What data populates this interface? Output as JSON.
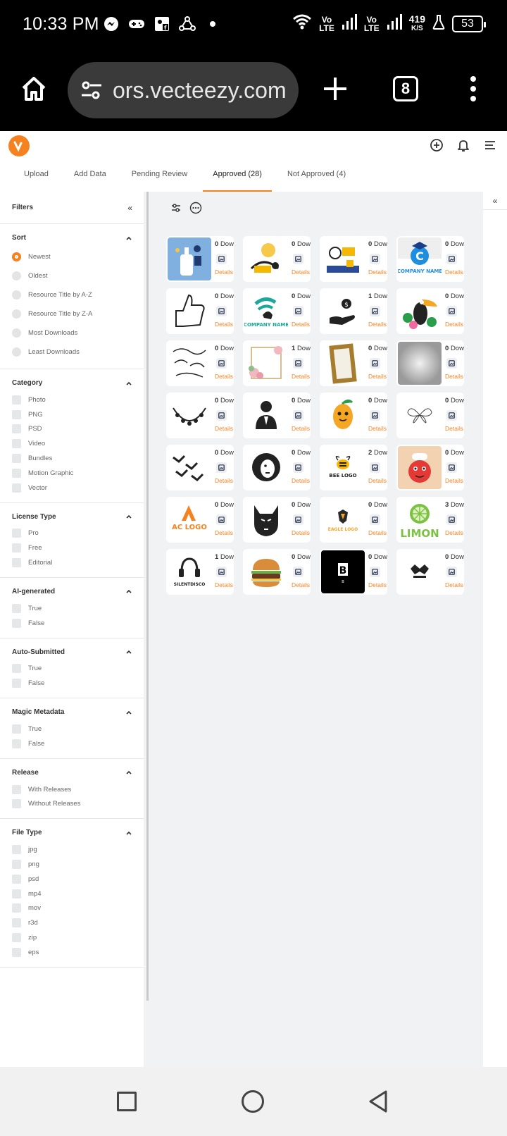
{
  "status": {
    "time": "10:33 PM",
    "lte1_top": "Vo",
    "lte1_bottom": "LTE",
    "lte2_top": "Vo",
    "lte2_bottom": "LTE",
    "speed_value": "419",
    "speed_unit": "K/S",
    "battery": "53",
    "icons_left": [
      "messenger-icon",
      "gamepad-icon",
      "facebook-contact-icon",
      "network-icon",
      "dot-icon"
    ],
    "icons_right": [
      "wifi-icon",
      "signal-icon",
      "signal-icon",
      "flask-icon",
      "battery-icon"
    ]
  },
  "browser": {
    "url": "ors.vecteezy.com",
    "tab_count": "8"
  },
  "header": {
    "tabs": [
      {
        "label": "Upload"
      },
      {
        "label": "Add Data"
      },
      {
        "label": "Pending Review"
      },
      {
        "label": "Approved (28)"
      },
      {
        "label": "Not Approved (4)"
      }
    ],
    "active_tab": "Approved (28)",
    "accent": "#f5821f"
  },
  "sidebar": {
    "title": "Filters",
    "sort": {
      "title": "Sort",
      "options": [
        "Newest",
        "Oldest",
        "Resource Title by A-Z",
        "Resource Title by Z-A",
        "Most Downloads",
        "Least Downloads"
      ],
      "selected": "Newest"
    },
    "category": {
      "title": "Category",
      "options": [
        "Photo",
        "PNG",
        "PSD",
        "Video",
        "Bundles",
        "Motion Graphic",
        "Vector"
      ]
    },
    "license": {
      "title": "License Type",
      "options": [
        "Pro",
        "Free",
        "Editorial"
      ]
    },
    "ai": {
      "title": "AI-generated",
      "options": [
        "True",
        "False"
      ]
    },
    "auto": {
      "title": "Auto-Submitted",
      "options": [
        "True",
        "False"
      ]
    },
    "magic": {
      "title": "Magic Metadata",
      "options": [
        "True",
        "False"
      ]
    },
    "release": {
      "title": "Release",
      "options": [
        "With Releases",
        "Without Releases"
      ]
    },
    "filetype": {
      "title": "File Type",
      "options": [
        "jpg",
        "png",
        "psd",
        "mp4",
        "mov",
        "r3d",
        "zip",
        "eps"
      ]
    }
  },
  "grid": {
    "details_label": "Details",
    "items": [
      {
        "downloads": "0",
        "suffix": "Downlo",
        "thumb": "hand-robot"
      },
      {
        "downloads": "0",
        "suffix": "Downlo",
        "thumb": "person-idea"
      },
      {
        "downloads": "0",
        "suffix": "Downlo",
        "thumb": "search-scene"
      },
      {
        "downloads": "0",
        "suffix": "Downloac",
        "thumb": "company-c",
        "text": "COMPANY NAME"
      },
      {
        "downloads": "0",
        "suffix": "Downlo",
        "thumb": "thumbs-up"
      },
      {
        "downloads": "0",
        "suffix": "Downlo",
        "thumb": "company-wave",
        "text": "COMPANY NAME"
      },
      {
        "downloads": "1",
        "suffix": "Downlo",
        "thumb": "hand-money"
      },
      {
        "downloads": "0",
        "suffix": "Downloac",
        "thumb": "toucan"
      },
      {
        "downloads": "0",
        "suffix": "Downlo",
        "thumb": "ornaments"
      },
      {
        "downloads": "1",
        "suffix": "Downlo",
        "thumb": "floral-frame"
      },
      {
        "downloads": "0",
        "suffix": "Downlo",
        "thumb": "gold-frame"
      },
      {
        "downloads": "0",
        "suffix": "Downloac",
        "thumb": "gray-gradient"
      },
      {
        "downloads": "0",
        "suffix": "Downlo",
        "thumb": "wreath"
      },
      {
        "downloads": "0",
        "suffix": "Downlo",
        "thumb": "person-icon"
      },
      {
        "downloads": "0",
        "suffix": "Downlo",
        "thumb": "mango"
      },
      {
        "downloads": "0",
        "suffix": "Downloac",
        "thumb": "butterfly"
      },
      {
        "downloads": "0",
        "suffix": "Downlo",
        "thumb": "birds"
      },
      {
        "downloads": "0",
        "suffix": "Downlo",
        "thumb": "lion"
      },
      {
        "downloads": "2",
        "suffix": "Downlo",
        "thumb": "bee-logo",
        "text": "BEE LOGO"
      },
      {
        "downloads": "0",
        "suffix": "Downloac",
        "thumb": "tomato-chef"
      },
      {
        "downloads": "0",
        "suffix": "Downlo",
        "thumb": "ac-logo",
        "text": "AC LOGO"
      },
      {
        "downloads": "0",
        "suffix": "Downlo",
        "thumb": "wolf"
      },
      {
        "downloads": "0",
        "suffix": "Downlo",
        "thumb": "eagle-logo",
        "text": "EAGLE LOGO"
      },
      {
        "downloads": "3",
        "suffix": "Downloac",
        "thumb": "limon",
        "text": "LIMON"
      },
      {
        "downloads": "1",
        "suffix": "Downlo",
        "thumb": "silent-disco",
        "text": "SILENTDISCO"
      },
      {
        "downloads": "0",
        "suffix": "Downlo",
        "thumb": "burger"
      },
      {
        "downloads": "0",
        "suffix": "Downlo",
        "thumb": "b-logo",
        "text": "B"
      },
      {
        "downloads": "0",
        "suffix": "Downloac",
        "thumb": "wing-logo"
      }
    ]
  }
}
